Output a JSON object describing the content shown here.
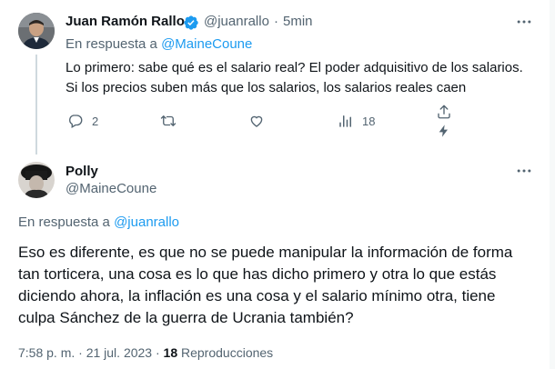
{
  "tweet1": {
    "display_name": "Juan Ramón Rallo",
    "handle": "@juanrallo",
    "separator": "·",
    "time": "5min",
    "reply_prefix": "En respuesta a ",
    "reply_handle": "@MaineCoune",
    "text_line1": "Lo primero: sabe qué es el salario real? El poder adquisitivo de los salarios.",
    "text_line2": "Si los precios suben más que los salarios, los salarios reales caen",
    "replies_count": "2",
    "views_count": "18",
    "verified": true
  },
  "tweet2": {
    "display_name": "Polly",
    "handle": "@MaineCoune",
    "reply_prefix": "En respuesta a ",
    "reply_handle": "@juanrallo",
    "text_line1": "Eso es diferente, es que no se puede manipular la información de forma",
    "text_line2": "tan torticera, una cosa es lo que has dicho primero y otra lo que estás",
    "text_line3": "diciendo ahora, la inflación es una cosa y el salario mínimo otra, tiene",
    "text_line4": "culpa Sánchez de la guerra de Ucrania también?",
    "timestamp": "7:58 p. m. · 21 jul. 2023 · ",
    "views_count": "18",
    "views_label": " Reproducciones"
  },
  "colors": {
    "accent": "#1d9bf0",
    "muted": "#536471",
    "text": "#0f1419",
    "divider": "#eff3f4"
  },
  "icons": [
    "more-icon",
    "verified-badge-icon",
    "reply-icon",
    "retweet-icon",
    "like-icon",
    "views-icon",
    "share-icon",
    "lightning-icon"
  ]
}
